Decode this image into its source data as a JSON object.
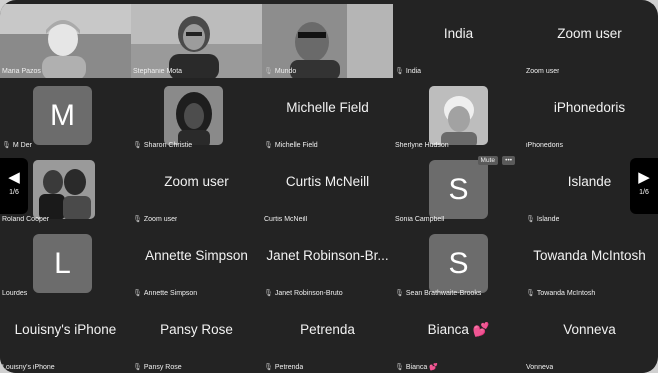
{
  "nav": {
    "prev_page": "1/6",
    "next_page": "1/6"
  },
  "row1": {
    "maria": "Maria Pazos",
    "stephanie": "Stephanie Mota",
    "mundo": "Mundo",
    "india_big": "India",
    "india": "India",
    "zoom_big": "Zoom user",
    "zoom": "Zoom user"
  },
  "row2": {
    "mder_initial": "M",
    "mder": "M Der",
    "sharon": "Sharon Christie",
    "michelle_big": "Michelle Field",
    "michelle": "Michelle Field",
    "sherlyne": "Sherlyne Hudson",
    "iphonedoris_big": "iPhonedoris",
    "iphonedoris": "iPhonedoris"
  },
  "row3": {
    "roland": "Roland Cooper",
    "zoomuser_big": "Zoom user",
    "zoomuser": "Zoom user",
    "curtis_big": "Curtis McNeill",
    "curtis": "Curtis McNeill",
    "sonia_initial": "S",
    "sonia": "Sonia Campbell",
    "mute_label": "Mute",
    "more_label": "•••",
    "islande_big": "Islande",
    "islande": "Islande"
  },
  "row4": {
    "lourdes_initial": "L",
    "lourdes": "Lourdes",
    "annette_big": "Annette Simpson",
    "annette": "Annette Simpson",
    "janet_big": "Janet Robinson-Br...",
    "janet": "Janet Robinson-Bruto",
    "sean_initial": "S",
    "sean": "Sean Brathwaite-Brooks",
    "towanda_big": "Towanda McIntosh",
    "towanda": "Towanda McIntosh"
  },
  "row5": {
    "louisny_big": "Louisny's iPhone",
    "louisny": "Louisny's iPhone",
    "pansy_big": "Pansy Rose",
    "pansy": "Pansy Rose",
    "petrenda_big": "Petrenda",
    "petrenda": "Petrenda",
    "bianca_big": "Bianca 💕",
    "bianca": "Bianca 💕",
    "vonneva_big": "Vonneva",
    "vonneva": "Vonneva"
  },
  "icons": {
    "muted_mic": "muted-mic-icon",
    "prev": "chevron-left-icon",
    "next": "chevron-right-icon"
  }
}
